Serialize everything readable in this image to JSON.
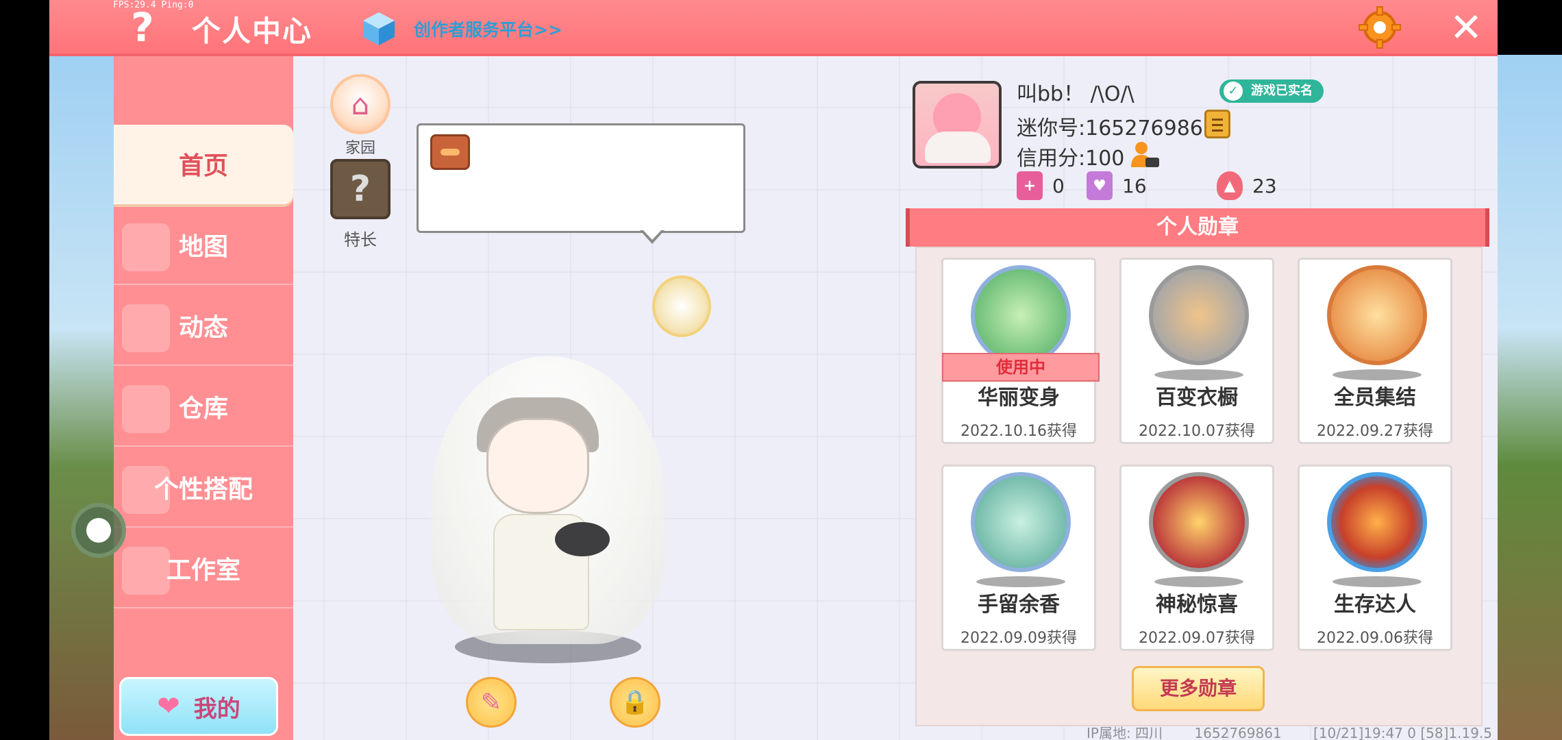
{
  "status": {
    "fps_text": "FPS:29.4  Ping:0"
  },
  "header": {
    "title": "个人中心",
    "creator_link": "创作者服务平台>>",
    "help_icon": "question-mark-icon",
    "settings_icon": "gear-icon",
    "close_icon": "close-icon"
  },
  "sidebar": {
    "items": [
      {
        "label": "首页",
        "active": true
      },
      {
        "label": "地图",
        "active": false
      },
      {
        "label": "动态",
        "active": false
      },
      {
        "label": "仓库",
        "active": false
      },
      {
        "label": "个性搭配",
        "active": false
      },
      {
        "label": "工作室",
        "active": false
      }
    ],
    "my_button": "我的"
  },
  "stage": {
    "home_label": "家园",
    "skill_label": "特长",
    "skill_glyph": "?"
  },
  "profile": {
    "nickname": "叫bb！ /\\O/\\",
    "verified": "游戏已实名",
    "mini_id": "迷你号:1652769861",
    "credit": "信用分:100",
    "stats": {
      "bookmark": "0",
      "likes": "16",
      "fire": "23"
    }
  },
  "medals": {
    "title": "个人勋章",
    "in_use_label": "使用中",
    "items": [
      {
        "name": "华丽变身",
        "date": "2022.10.16获得",
        "in_use": true
      },
      {
        "name": "百变衣橱",
        "date": "2022.10.07获得",
        "in_use": false
      },
      {
        "name": "全员集结",
        "date": "2022.09.27获得",
        "in_use": false
      },
      {
        "name": "手留余香",
        "date": "2022.09.09获得",
        "in_use": false
      },
      {
        "name": "神秘惊喜",
        "date": "2022.09.07获得",
        "in_use": false
      },
      {
        "name": "生存达人",
        "date": "2022.09.06获得",
        "in_use": false
      }
    ],
    "more_button": "更多勋章"
  },
  "footer": {
    "ip": "IP属地: 四川",
    "uid": "1652769861",
    "time_version": "[10/21]19:47 0  [58]1.19.5"
  },
  "colors": {
    "topbar": "#ff7479",
    "sidebar": "#ff8f93",
    "accent": "#e2505a",
    "link": "#2f9dd6"
  }
}
